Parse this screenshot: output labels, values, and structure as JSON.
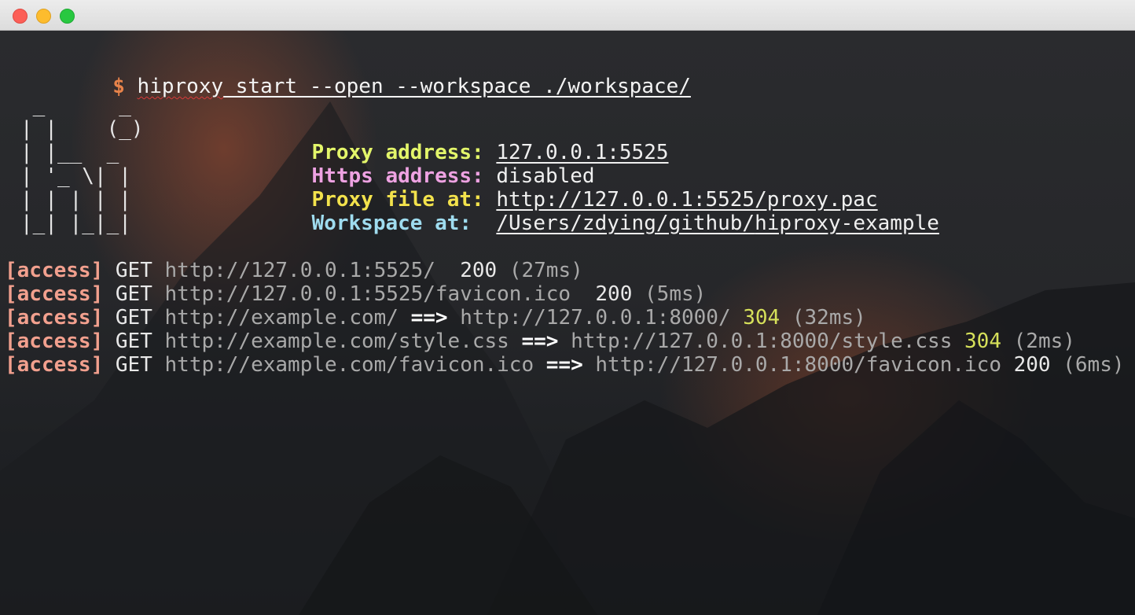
{
  "window": {
    "controls": [
      "close",
      "minimize",
      "maximize"
    ]
  },
  "terminal": {
    "prompt": "$",
    "command_a": "hiproxy",
    "command_b": " start --open --workspace ./workspace/",
    "banner": {
      "ascii": [
        " _      _",
        "| |    (_)",
        "| |__  _",
        "| '_ \\| |",
        "| | | | |",
        "|_| |_|_|"
      ],
      "info": [
        {
          "label": "Proxy address:",
          "value": "127.0.0.1:5525",
          "color": "#e3f56a"
        },
        {
          "label": "Https address:",
          "value": "disabled",
          "color": "#eea2e2"
        },
        {
          "label": "Proxy file at:",
          "value": "http://127.0.0.1:5525/proxy.pac",
          "color": "#f3e24c"
        },
        {
          "label": "Workspace at: ",
          "value_a": "/Users/zdying/github/",
          "value_b": "hiproxy-example",
          "color": "#9fdcef"
        }
      ]
    },
    "logs": [
      {
        "tag": "[access]",
        "method": "GET",
        "url": "http://127.0.0.1:5525/",
        "arrow": "",
        "target": "",
        "status": "200",
        "time": "(27ms)"
      },
      {
        "tag": "[access]",
        "method": "GET",
        "url": "http://127.0.0.1:5525/favicon.ico",
        "arrow": "",
        "target": "",
        "status": "200",
        "time": "(5ms)"
      },
      {
        "tag": "[access]",
        "method": "GET",
        "url": "http://example.com/",
        "arrow": "==>",
        "target": "http://127.0.0.1:8000/",
        "status": "304",
        "time": "(32ms)"
      },
      {
        "tag": "[access]",
        "method": "GET",
        "url": "http://example.com/style.css",
        "arrow": "==>",
        "target": "http://127.0.0.1:8000/style.css",
        "status": "304",
        "time": "(2ms)"
      },
      {
        "tag": "[access]",
        "method": "GET",
        "url": "http://example.com/favicon.ico",
        "arrow": "==>",
        "target": "http://127.0.0.1:8000/favicon.ico",
        "status": "200",
        "time": "(6ms)"
      }
    ]
  }
}
